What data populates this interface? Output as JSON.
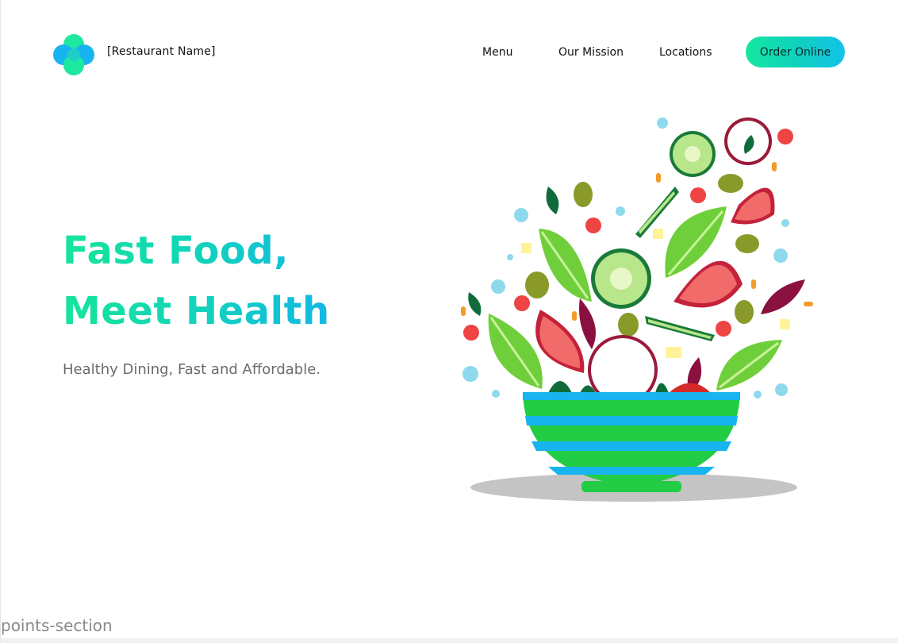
{
  "header": {
    "brand_name": "[Restaurant Name]",
    "logo_icon": "clover-logo-icon",
    "nav": [
      {
        "label": "Menu"
      },
      {
        "label": "Our Mission"
      },
      {
        "label": "Locations"
      }
    ],
    "cta_label": "Order Online"
  },
  "hero": {
    "title_line1": "Fast Food,",
    "title_line2": "Meet Health",
    "subtitle": "Healthy Dining, Fast and Affordable.",
    "illustration_icon": "salad-bowl-illustration"
  },
  "section_anchor": "points-section",
  "colors": {
    "accent_green": "#13e79f",
    "accent_blue": "#13c2e8",
    "bowl_green": "#22cc44",
    "bowl_blue": "#18b4f0"
  }
}
